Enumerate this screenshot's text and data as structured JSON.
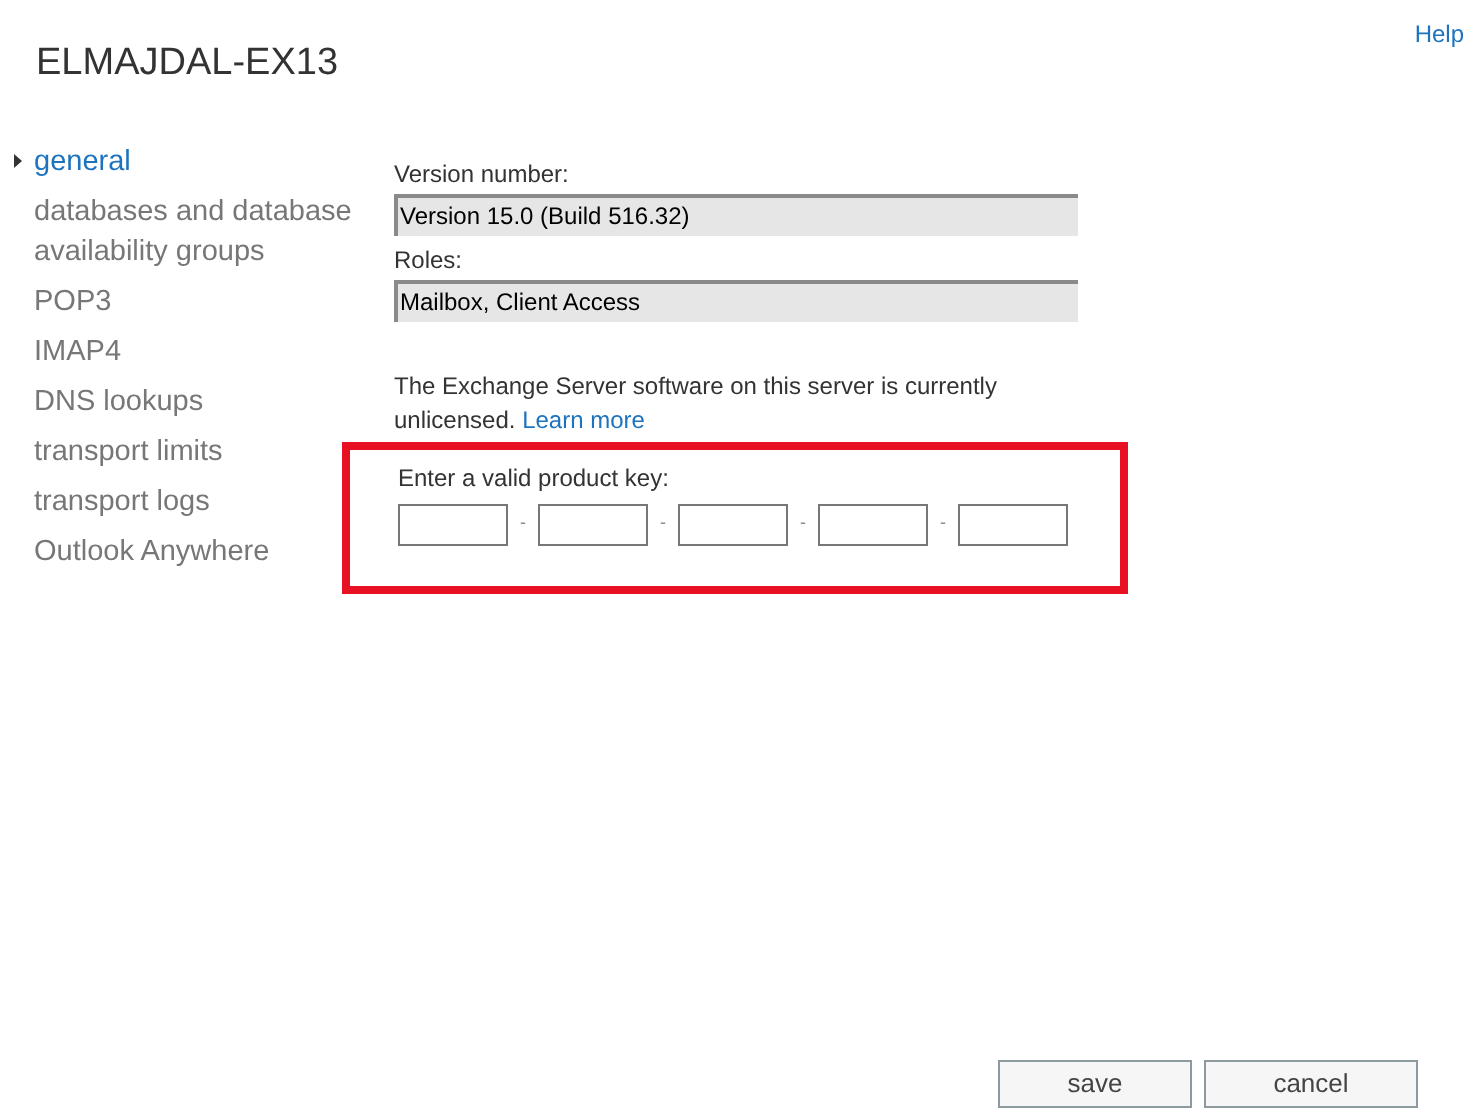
{
  "help_link": "Help",
  "title": "ELMAJDAL-EX13",
  "sidebar": {
    "items": [
      {
        "label": "general",
        "selected": true
      },
      {
        "label": "databases and database availability groups",
        "selected": false
      },
      {
        "label": "POP3",
        "selected": false
      },
      {
        "label": "IMAP4",
        "selected": false
      },
      {
        "label": "DNS lookups",
        "selected": false
      },
      {
        "label": "transport limits",
        "selected": false
      },
      {
        "label": "transport logs",
        "selected": false
      },
      {
        "label": "Outlook Anywhere",
        "selected": false
      }
    ]
  },
  "fields": [
    {
      "label": "Version number:",
      "value": "Version 15.0 (Build 516.32)"
    },
    {
      "label": "Roles:",
      "value": "Mailbox, Client Access"
    }
  ],
  "license_notice": {
    "text": "The Exchange Server software on this server is currently unlicensed.",
    "link": "Learn more"
  },
  "product_key": {
    "label": "Enter a valid product key:",
    "separators": [
      "-",
      "-",
      "-",
      "-"
    ],
    "highlighted": true
  },
  "buttons": [
    "save",
    "cancel"
  ]
}
